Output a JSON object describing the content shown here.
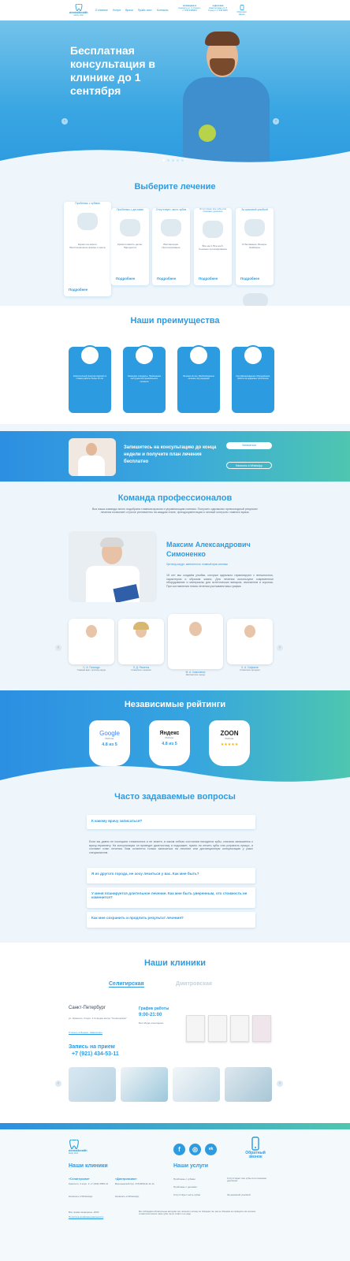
{
  "header": {
    "logo": "dentalhealth",
    "logo_sub": "family clinic",
    "nav": [
      "О клинике",
      "Услуги",
      "Врачи",
      "Прайс-лист",
      "Контакты"
    ],
    "addr1_title": "м.Невидимое",
    "addr1": "Красного ул. 4, Город 1 +7 495 3085810",
    "addr2_title": "м.Деловая",
    "addr2": "Новоторговая ул. 8 Город 2 +7 495 3845",
    "callback": "Обратный звонок"
  },
  "hero": {
    "title": "Бесплатная консультация в клинике до 1 сентября",
    "prev": "‹",
    "next": "›"
  },
  "treatment": {
    "title": "Выберите лечение",
    "cards": [
      {
        "title": "Проблемы с зубами",
        "text": "Кариес на эмали. Восстановление формы и цвета",
        "more": "Подробнее"
      },
      {
        "title": "Проблемы с деснами",
        "text": "Кровоточивость десен. Пародонтоз",
        "more": "Подробнее"
      },
      {
        "title": "Отсутствует часть зубов",
        "text": "Имплантация. Протезирование",
        "more": "Подробнее"
      },
      {
        "title": "Отсутствуют все зубы или показано удаление",
        "text": "Все-на-4. Все-на-6. Съемное протезирование",
        "more": "Подробнее"
      },
      {
        "title": "За красивой улыбкой",
        "text": "Отбеливание. Виниры. Элайнеры",
        "more": "Подробнее"
      }
    ]
  },
  "advantages": {
    "title": "Наши преимущества",
    "items": [
      "Компетентный персонал врачей со стажем работы более 10 лет",
      "Немецкие стандарты. Применение инструментов премиального сегмента",
      "Лечение во сне. Безболезненное лечение под седацией",
      "Сертифицированное оборудование, работа на цифровых протоколах"
    ]
  },
  "cta": {
    "text": "Запишитесь на консультацию до конца недели и получите план лечения бесплатно",
    "btn1": "Записаться",
    "btn2": "Написать в WhatsApp"
  },
  "team": {
    "title": "Команда профессионалов",
    "intro": "Вся наша команда лично подобрана главным врачом и управляющим клиники. Получить одинаково превосходный результат лечения позволяет строгое регламенты на каждом этапе, фотодокументация и личный контроль главного врача.",
    "name": "Максим Александрович Симоненко",
    "role": "Ортопед-хирург, имплантолог, главный врач клиники",
    "desc": "15 лет мы создаём улыбки, которые идеально гармонируют с внешностью, характером и образом жизни. Для лечения используем современное оборудование и материалы для эстетических виниров, имплантов и коронок. При составлении плана лечения учитываем ваш график.",
    "doctors": [
      {
        "name": "С. А. Полищук",
        "role": "Главный врач, ортопед-хирург"
      },
      {
        "name": "Л. Д. Решеток",
        "role": "Стоматолог-терапевт"
      },
      {
        "name": "М. А. Симоненко",
        "role": "Имплантолог-хирург"
      },
      {
        "name": "К. А. Сафонов",
        "role": "Стоматолог-ортодонт"
      }
    ]
  },
  "ratings": {
    "title": "Независимые рейтинги",
    "items": [
      {
        "brand": "Google",
        "sub": "Рейтинг",
        "score": "4.8 из 5"
      },
      {
        "brand": "Яндекс",
        "sub": "Рейтинг",
        "score": "4.8 из 5"
      },
      {
        "brand": "ZOON",
        "sub": "Рейтинг",
        "score": "★★★★★"
      }
    ]
  },
  "faq": {
    "title": "Часто задаваемые вопросы",
    "q1": "К какому врачу записаться?",
    "a1": "Если вы давно не посещали стоматолога и не знаете, в каком сейчас состоянии находятся зубы, сначала запишитесь к врачу-терапевту. На консультации он проведет диагностику и подскажет, нужно ли лечить зубы или устранить прикус, и составит план лечения. Вам останется только записаться на лечение или дистанционную консультацию у узких специалистов.",
    "q2": "Я из другого города, не хочу лечиться у вас. Как мне быть?",
    "q3": "У меня планируется длительное лечение. Как мне быть уверенным, что стоимость не изменится?",
    "q4": "Как мне сохранить и продлить результат лечения?"
  },
  "clinics": {
    "title": "Наши клиники",
    "tab1": "Селигирская",
    "tab2": "Дмитровская",
    "city": "Санкт-Петербург",
    "addr": "ул. Красного, 3 корп. 2 Станция метро \"Селигерская\"",
    "map": "Открыть в Яндекс. Навигаторе",
    "sched_title": "График работы",
    "sched": "9:00-21:00",
    "sched_sub": "Без обеда и выходных",
    "appt": "Запись на прием",
    "phone": "+7 (921) 434-53-11"
  },
  "footer": {
    "logo": "dentalhealth",
    "logo_sub": "family clinic",
    "clinics_title": "Наши клиники",
    "c1_name": "«Селигерская»",
    "c1_addr": "Красного, 3 корп. 2 +7 (499) 3959 12",
    "c2_name": "«Дмитровская»",
    "c2_addr": "Воронежский бул. 8 8(495)111-11-11",
    "c1_link": "Написать в WhatsApp",
    "c2_link": "Написать в WhatsApp",
    "services_title": "Наши услуги",
    "services": [
      "Проблемы с зубами",
      "Проблемы с деснами",
      "Отсутствует часть зубов",
      "Отсутствуют все зубы или показано удаление",
      "За красивой улыбкой"
    ],
    "callback": "Обратный звонок",
    "copyright": "Все права защищены. 2020",
    "policy": "Политика конфиденциальности",
    "disclaimer": "Мы соблюдаем обязательные методики при лечении и ничему не обещаем так, как не обещаем не проводить как лечение стоматологическое такое зубы так не ставят и не надо.",
    "social": [
      "f",
      "◎",
      "vk"
    ]
  },
  "colors": {
    "primary": "#2d9be0",
    "teal": "#4ec6b0",
    "bg": "#eef6fc"
  }
}
